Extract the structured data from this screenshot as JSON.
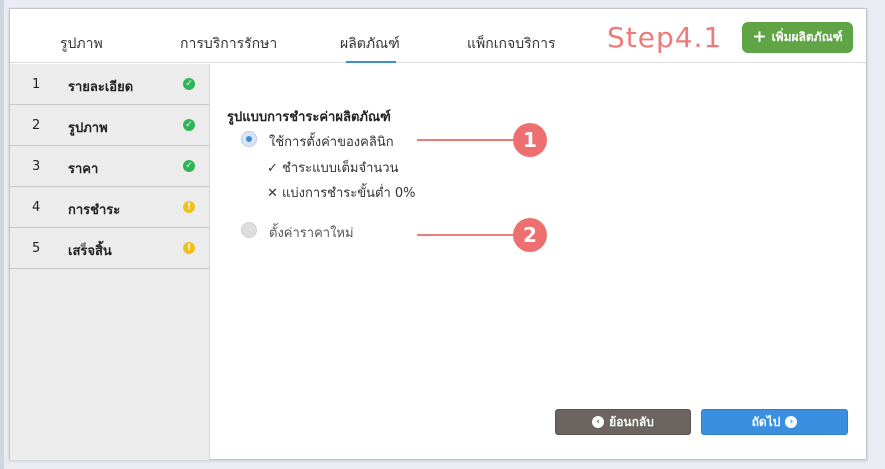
{
  "tabs": [
    {
      "label": "รูปภาพ"
    },
    {
      "label": "การบริการรักษา"
    },
    {
      "label": "ผลิตภัณฑ์"
    },
    {
      "label": "แพ็กเกจบริการ"
    }
  ],
  "step_label": "Step4.1",
  "add_button": {
    "icon": "plus-icon",
    "label": "เพิ่มผลิตภัณฑ์"
  },
  "sidebar": {
    "items": [
      {
        "num": "1",
        "label": "รายละเอียด",
        "status": "ok"
      },
      {
        "num": "2",
        "label": "รูปภาพ",
        "status": "ok"
      },
      {
        "num": "3",
        "label": "ราคา",
        "status": "ok"
      },
      {
        "num": "4",
        "label": "การชำระ",
        "status": "warn"
      },
      {
        "num": "5",
        "label": "เสร็จสิ้น",
        "status": "warn"
      }
    ]
  },
  "status_glyphs": {
    "ok": "✓",
    "warn": "!"
  },
  "main": {
    "section_title": "รูปแบบการชำระค่าผลิตภัณฑ์",
    "option1": {
      "label": "ใช้การตั้งค่าของคลินิก",
      "checked": true,
      "details": [
        {
          "glyph": "✓",
          "text": "ชำระแบบเต็มจำนวน"
        },
        {
          "glyph": "✕",
          "text": "แบ่งการชำระขั้นต่ำ 0%"
        }
      ]
    },
    "option2": {
      "label": "ตั้งค่าราคาใหม่",
      "checked": false
    },
    "callouts": [
      "1",
      "2"
    ]
  },
  "buttons": {
    "back_label": "ย้อนกลับ",
    "back_icon": "‹",
    "next_label": "ถัดไป",
    "next_icon": "›"
  },
  "colors": {
    "accent": "#3e8ed0",
    "add_button": "#5fa545",
    "step_label": "#ee7b7b",
    "ok": "#2fb457",
    "warn": "#f2c01e",
    "back_button": "#6b6461",
    "next_button": "#3a8fe0"
  }
}
